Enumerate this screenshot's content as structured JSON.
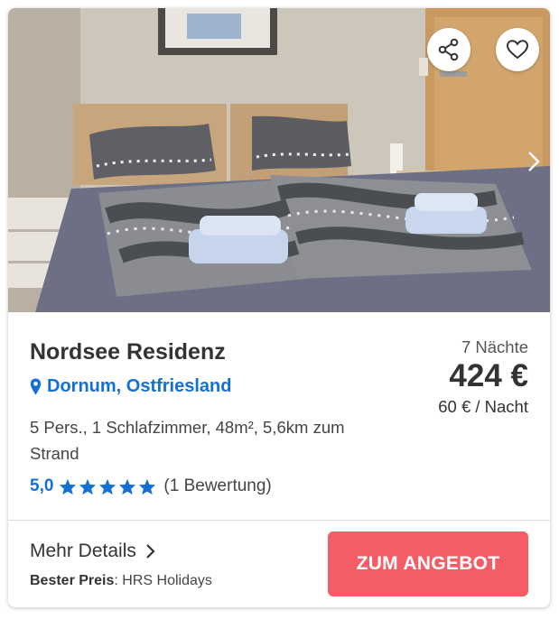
{
  "listing": {
    "image_alt": "Schlafzimmer mit Doppelbett",
    "title": "Nordsee Residenz",
    "location": "Dornum, Ostfriesland",
    "details": "5 Pers., 1 Schlafzimmer, 48m², 5,6km zum Strand",
    "rating": {
      "score_text": "5,0",
      "score": 5.0,
      "stars_filled": 5,
      "stars_total": 5,
      "count_text": "(1 Bewertung)"
    },
    "price": {
      "nights": "7 Nächte",
      "total": "424 €",
      "per_night": "60 € / Nacht"
    }
  },
  "footer": {
    "more_details": "Mehr Details",
    "best_price_label": "Bester Preis",
    "best_price_provider": ": HRS Holidays",
    "cta_label": "ZUM ANGEBOT"
  },
  "icons": {
    "share": "share-icon",
    "favorite": "heart-icon",
    "next": "chevron-right-icon",
    "location": "map-pin-icon",
    "star": "star-icon",
    "more": "chevron-right-icon"
  },
  "colors": {
    "accent_blue": "#1570d6",
    "cta_red": "#f45d66",
    "text_dark": "#333333"
  }
}
